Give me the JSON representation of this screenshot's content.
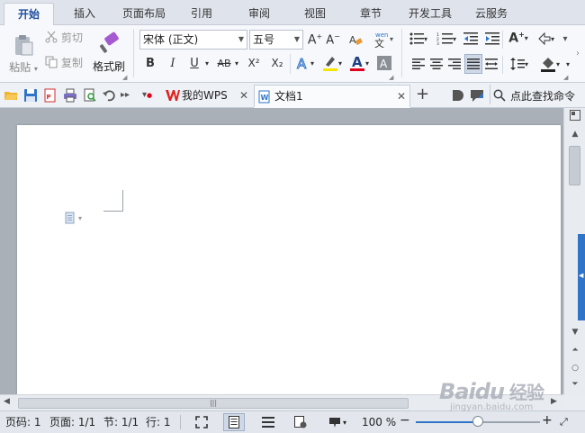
{
  "menu": {
    "tabs": [
      {
        "label": "开始",
        "active": true
      },
      {
        "label": "插入"
      },
      {
        "label": "页面布局"
      },
      {
        "label": "引用"
      },
      {
        "label": "审阅"
      },
      {
        "label": "视图"
      },
      {
        "label": "章节"
      },
      {
        "label": "开发工具"
      },
      {
        "label": "云服务"
      }
    ]
  },
  "ribbon": {
    "paste_label": "粘贴",
    "cut_label": "剪切",
    "copy_label": "复制",
    "format_painter_label": "格式刷",
    "font_name": "宋体 (正文)",
    "font_size": "五号",
    "bold": "B",
    "italic": "I",
    "underline": "U",
    "strikethrough": "AB",
    "superscript": "X²",
    "subscript": "X₂",
    "colors": {
      "highlight": "#f6e500",
      "font_color": "#e0001b",
      "accent": "#2f74c8"
    }
  },
  "quickbar": {
    "tabs": [
      {
        "label": "我的WPS",
        "icon": "wps-logo-icon"
      },
      {
        "label": "文档1",
        "icon": "doc-icon",
        "active": true
      }
    ],
    "search_label": "点此查找命令"
  },
  "status": {
    "page_number": "页码: 1",
    "pages": "页面: 1/1",
    "section": "节: 1/1",
    "line": "行: 1",
    "zoom_percent": "100 %",
    "zoom_level": 0.5
  },
  "watermark": {
    "brand": "Baidu",
    "brand_cn": "经验",
    "url": "jingyan.baidu.com"
  }
}
